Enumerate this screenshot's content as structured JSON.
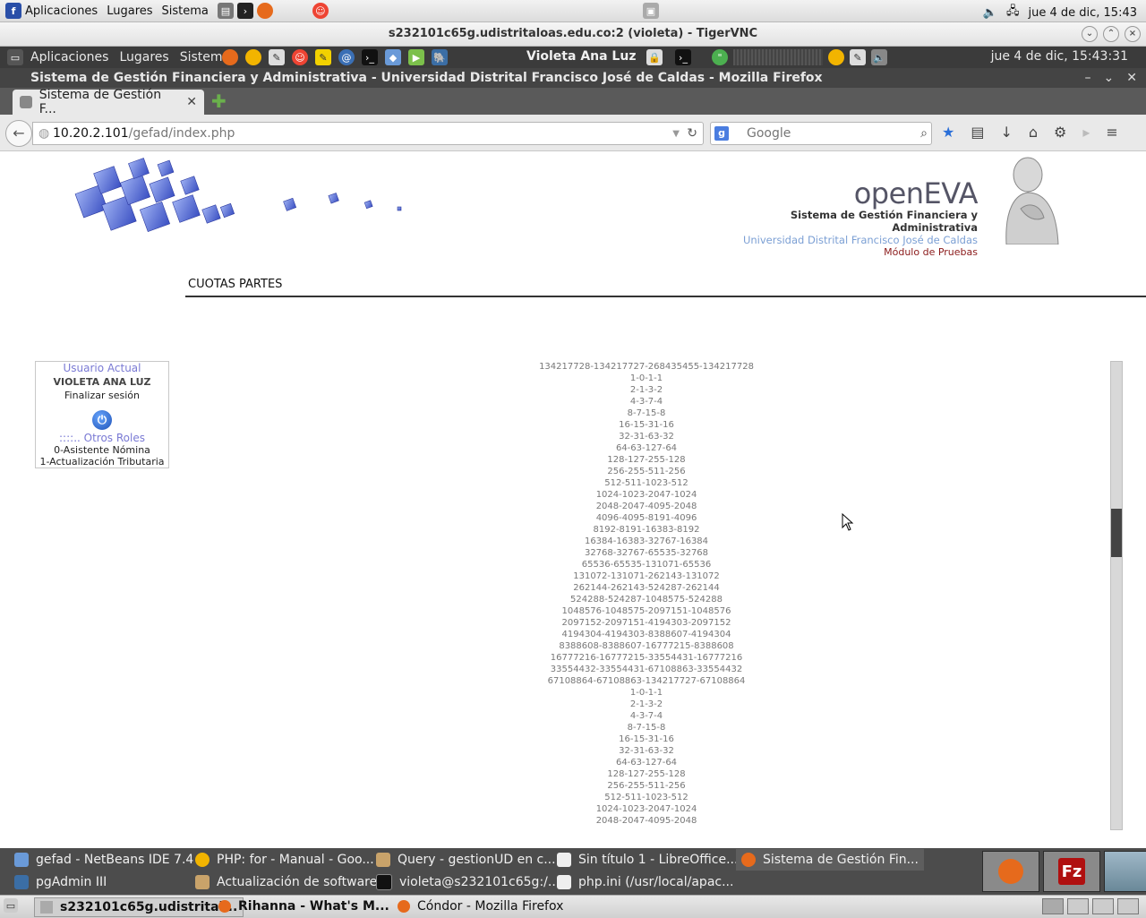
{
  "host": {
    "menu": [
      "Aplicaciones",
      "Lugares",
      "Sistema"
    ],
    "clock": "jue  4 de dic, 15:43"
  },
  "vnc": {
    "title": "s232101c65g.udistritaloas.edu.co:2 (violeta) - TigerVNC"
  },
  "remote": {
    "menu": [
      "Aplicaciones",
      "Lugares",
      "Sistema"
    ],
    "user": "Violeta Ana Luz",
    "clock": "jue  4 de dic, 15:43:31"
  },
  "firefox": {
    "window_title": "Sistema de Gestión Financiera y Administrativa - Universidad Distrital Francisco José de Caldas - Mozilla Firefox",
    "tab_label": "Sistema de Gestión F...",
    "url_host": "10.20.2.101",
    "url_path": "/gefad/index.php",
    "search_placeholder": "Google"
  },
  "header": {
    "brand": "openEVA",
    "line1": "Sistema de Gestión Financiera y Administrativa",
    "line2": "Universidad Distrital Francisco José de Caldas",
    "line3": "Módulo de Pruebas"
  },
  "section_title": "CUOTAS PARTES",
  "userbox": {
    "heading": "Usuario Actual",
    "name": "VIOLETA ANA LUZ",
    "logout": "Finalizar sesión",
    "roles_heading": "::::.. Otros Roles",
    "roles": [
      "0-Asistente Nómina",
      "1-Actualización Tributaria"
    ]
  },
  "output_lines": [
    "134217728-134217727-268435455-134217728",
    "1-0-1-1",
    "2-1-3-2",
    "4-3-7-4",
    "8-7-15-8",
    "16-15-31-16",
    "32-31-63-32",
    "64-63-127-64",
    "128-127-255-128",
    "256-255-511-256",
    "512-511-1023-512",
    "1024-1023-2047-1024",
    "2048-2047-4095-2048",
    "4096-4095-8191-4096",
    "8192-8191-16383-8192",
    "16384-16383-32767-16384",
    "32768-32767-65535-32768",
    "65536-65535-131071-65536",
    "131072-131071-262143-131072",
    "262144-262143-524287-262144",
    "524288-524287-1048575-524288",
    "1048576-1048575-2097151-1048576",
    "2097152-2097151-4194303-2097152",
    "4194304-4194303-8388607-4194304",
    "8388608-8388607-16777215-8388608",
    "16777216-16777215-33554431-16777216",
    "33554432-33554431-67108863-33554432",
    "67108864-67108863-134217727-67108864",
    "1-0-1-1",
    "2-1-3-2",
    "4-3-7-4",
    "8-7-15-8",
    "16-15-31-16",
    "32-31-63-32",
    "64-63-127-64",
    "128-127-255-128",
    "256-255-511-256",
    "512-511-1023-512",
    "1024-1023-2047-1024",
    "2048-2047-4095-2048"
  ],
  "scroll_position_fraction": 0.35,
  "taskbar_row1": [
    "gefad - NetBeans IDE 7.4",
    "PHP: for - Manual - Goo...",
    "Query - gestionUD en c...",
    "Sin título 1 - LibreOffice...",
    "Sistema de Gestión Fin..."
  ],
  "taskbar_row2": [
    "pgAdmin III",
    "Actualización de software",
    "violeta@s232101c65g:/...",
    "php.ini (/usr/local/apac..."
  ],
  "host_tasks": [
    "s232101c65g.udistrital...",
    "Rihanna - What's M...",
    "Cóndor - Mozilla Firefox"
  ]
}
